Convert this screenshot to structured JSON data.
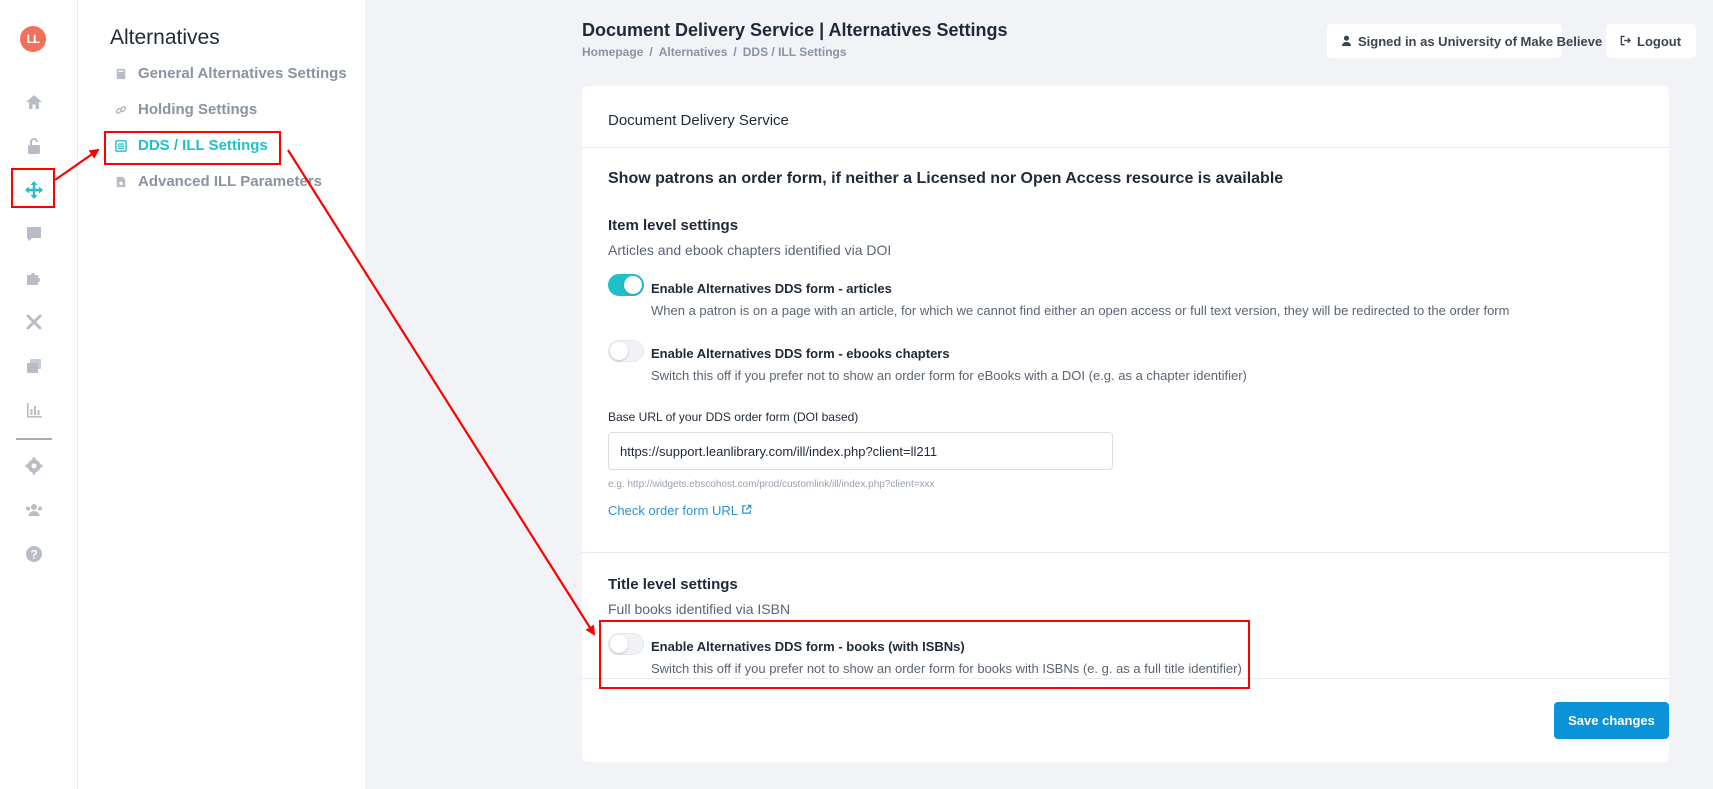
{
  "app": {
    "logo_text": "LL"
  },
  "rail": {
    "icons": [
      {
        "name": "home-icon",
        "active": false
      },
      {
        "name": "unlock-icon",
        "active": false
      },
      {
        "name": "move-arrows-icon",
        "active": true
      },
      {
        "name": "comment-icon",
        "active": false
      },
      {
        "name": "puzzle-icon",
        "active": false
      },
      {
        "name": "tools-icon",
        "active": false
      },
      {
        "name": "stack-icon",
        "active": false
      },
      {
        "name": "chart-icon",
        "active": false
      },
      {
        "name": "gear-icon",
        "active": false
      },
      {
        "name": "users-icon",
        "active": false
      },
      {
        "name": "help-icon",
        "active": false
      }
    ]
  },
  "subnav": {
    "title": "Alternatives",
    "items": [
      {
        "label": "General Alternatives Settings",
        "icon": "book-icon",
        "active": false
      },
      {
        "label": "Holding Settings",
        "icon": "link-icon",
        "active": false
      },
      {
        "label": "DDS / ILL Settings",
        "icon": "form-icon",
        "active": true
      },
      {
        "label": "Advanced ILL Parameters",
        "icon": "file-settings-icon",
        "active": false
      }
    ]
  },
  "header": {
    "title": "Document Delivery Service | Alternatives Settings",
    "breadcrumb": [
      "Homepage",
      "Alternatives",
      "DDS / ILL Settings"
    ],
    "signed_in": "Signed in as University of Make Believe",
    "logout": "Logout"
  },
  "card": {
    "heading": "Document Delivery Service",
    "main_title": "Show patrons an order form, if neither a Licensed nor Open Access resource is available",
    "item_level": {
      "title": "Item level settings",
      "subtitle": "Articles and ebook chapters identified via DOI",
      "options": [
        {
          "title": "Enable Alternatives DDS form - articles",
          "desc": "When a patron is on a page with an article, for which we cannot find either an open access or full text version, they will be redirected to the order form",
          "enabled": true
        },
        {
          "title": "Enable Alternatives DDS form - ebooks chapters",
          "desc": "Switch this off if you prefer not to show an order form for eBooks with a DOI (e.g. as a chapter identifier)",
          "enabled": false
        }
      ],
      "base_url_label": "Base URL of your DDS order form (DOI based)",
      "base_url_value": "https://support.leanlibrary.com/ill/index.php?client=ll211",
      "base_url_hint": "e.g. http://widgets.ebscohost.com/prod/customlink/ill/index.php?client=xxx",
      "check_link": "Check order form URL"
    },
    "title_level": {
      "title": "Title level settings",
      "subtitle": "Full books identified via ISBN",
      "option": {
        "title": "Enable Alternatives DDS form - books (with ISBNs)",
        "desc": "Switch this off if you prefer not to show an order form for books with ISBNs (e. g. as a full title identifier)",
        "enabled": false
      }
    },
    "save_label": "Save changes"
  },
  "colors": {
    "accent": "#1ec1c8",
    "primary_button": "#0a93d8",
    "link": "#2a91d6",
    "annotation": "#ff0000",
    "logo": "#f2705a"
  }
}
